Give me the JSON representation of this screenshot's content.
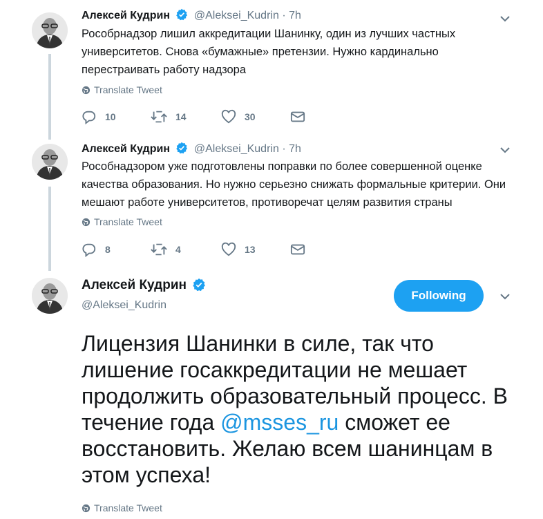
{
  "tweets": [
    {
      "name": "Алексей Кудрин",
      "handle": "@Aleksei_Kudrin",
      "dot": "·",
      "time": "7h",
      "text": "Рособрнадзор лишил аккредитации Шанинку, один из лучших частных университетов. Снова «бумажные» претензии. Нужно кардинально перестраивать работу надзора",
      "translate": "Translate Tweet",
      "replies": "10",
      "retweets": "14",
      "likes": "30"
    },
    {
      "name": "Алексей Кудрин",
      "handle": "@Aleksei_Kudrin",
      "dot": "·",
      "time": "7h",
      "text": "Рособнадзором уже подготовлены поправки по более совершенной оценке качества образования. Но нужно серьезно снижать формальные критерии. Они мешают работе университетов, противоречат целям развития страны",
      "translate": "Translate Tweet",
      "replies": "8",
      "retweets": "4",
      "likes": "13"
    }
  ],
  "main": {
    "name": "Алексей Кудрин",
    "handle": "@Aleksei_Kudrin",
    "follow_label": "Following",
    "text_before": "Лицензия Шанинки в силе, так что лишение госаккредитации не мешает продолжить образовательный процесс. В течение года ",
    "mention": "@msses_ru",
    "text_after": " сможет ее восстановить. Желаю всем шанинцам в этом успеха!",
    "translate": "Translate Tweet"
  },
  "colors": {
    "accent": "#1da1f2",
    "mention": "#1b95e0",
    "secondary_text": "#657786",
    "thread_line": "#ccd6dd"
  },
  "icons": [
    "verified-icon",
    "globe-icon",
    "reply-icon",
    "retweet-icon",
    "like-icon",
    "dm-icon",
    "chevron-down-icon"
  ]
}
